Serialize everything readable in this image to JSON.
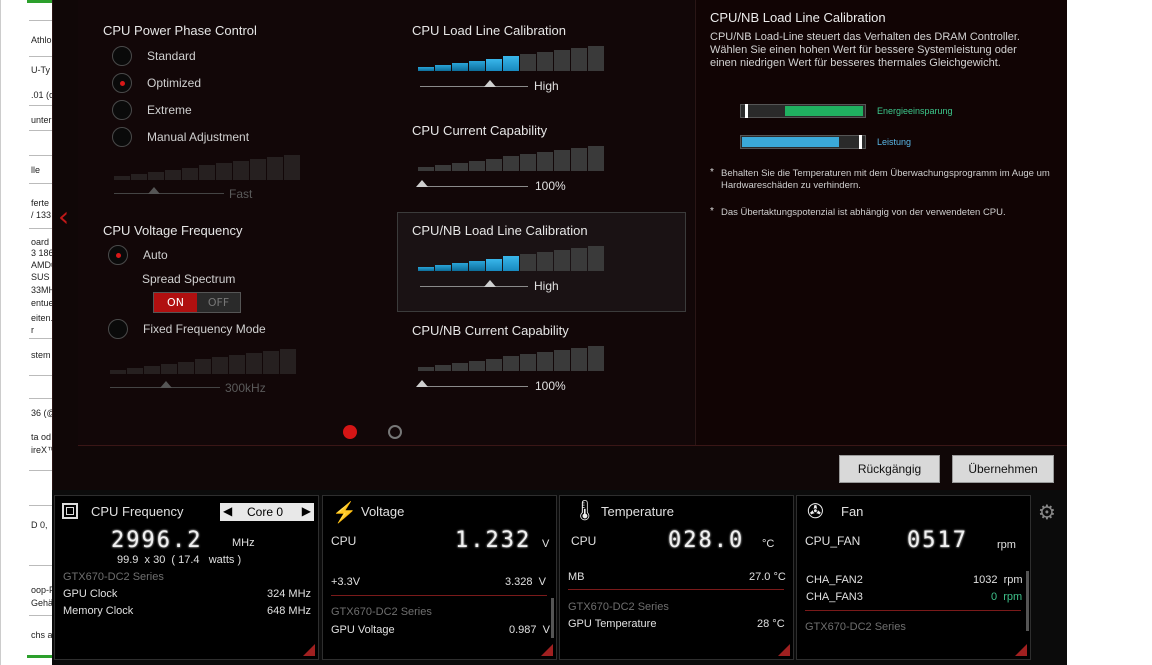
{
  "background_fragments": [
    "Athlo",
    "U-Ty",
    ".01 (c",
    "unter",
    "lle",
    "ferte",
    "/ 133",
    "oard",
    "3 186",
    "AMD®",
    "SUS",
    "33MH",
    "entue",
    "eiten.",
    "r",
    "stem",
    "36 (@",
    "ta od",
    "ireX™",
    "D 0,",
    "oop-F",
    "Gehäu",
    "chs a"
  ],
  "power_phase": {
    "title": "CPU Power Phase Control",
    "options": [
      "Standard",
      "Optimized",
      "Extreme",
      "Manual Adjustment"
    ],
    "selected": "Optimized",
    "slider_value": "Fast"
  },
  "voltage_freq": {
    "title": "CPU Voltage Frequency",
    "auto_label": "Auto",
    "spread_label": "Spread Spectrum",
    "on_label": "ON",
    "off_label": "OFF",
    "fixed_label": "Fixed Frequency Mode",
    "slider_value": "300kHz"
  },
  "llc": {
    "title": "CPU Load Line Calibration",
    "value": "High",
    "level": 0.55
  },
  "current_cap": {
    "title": "CPU Current Capability",
    "value": "100%",
    "level": 0.0
  },
  "nb_llc": {
    "title": "CPU/NB Load Line Calibration",
    "value": "High",
    "level": 0.55
  },
  "nb_current_cap": {
    "title": "CPU/NB Current Capability",
    "value": "100%",
    "level": 0.0
  },
  "help": {
    "title": "CPU/NB Load Line Calibration",
    "body": "CPU/NB Load-Line steuert das Verhalten des DRAM Controller. Wählen Sie einen hohen Wert für bessere Systemleistung oder einen niedrigen Wert für besseres thermales Gleichgewicht.",
    "meter1_label": "Energieeinsparung",
    "meter2_label": "Leistung",
    "note1": "Behalten Sie die Temperaturen mit dem Überwachungsprogramm im Auge um Hardwareschäden zu verhindern.",
    "note2": "Das Übertaktungspotenzial ist abhängig von der verwendeten CPU."
  },
  "buttons": {
    "undo": "Rückgängig",
    "apply": "Übernehmen"
  },
  "cpu_freq": {
    "title": "CPU Frequency",
    "core": "Core 0",
    "value": "2996.2",
    "unit": "MHz",
    "detail": "99.9  x 30  ( 17.4   watts )",
    "gpu_series": "GTX670-DC2 Series",
    "gpu_clock_label": "GPU Clock",
    "gpu_clock": "324 MHz",
    "mem_clock_label": "Memory Clock",
    "mem_clock": "648 MHz"
  },
  "voltage": {
    "title": "Voltage",
    "cpu_label": "CPU",
    "cpu_value": "1.232",
    "unit": "V",
    "v33_label": "+3.3V",
    "v33_value": "3.328  V",
    "gpu_series": "GTX670-DC2 Series",
    "gpu_v_label": "GPU Voltage",
    "gpu_v_value": "0.987  V"
  },
  "temperature": {
    "title": "Temperature",
    "cpu_label": "CPU",
    "cpu_value": "028.0",
    "unit": "°C",
    "mb_label": "MB",
    "mb_value": "27.0 °C",
    "gpu_series": "GTX670-DC2 Series",
    "gpu_t_label": "GPU Temperature",
    "gpu_t_value": "28 °C"
  },
  "fan": {
    "title": "Fan",
    "cpu_fan_label": "CPU_FAN",
    "cpu_fan_value": "0517",
    "unit": "rpm",
    "cha2_label": "CHA_FAN2",
    "cha2_value": "1032  rpm",
    "cha3_label": "CHA_FAN3",
    "cha3_value": "0  rpm",
    "gpu_series": "GTX670-DC2 Series"
  },
  "colors": {
    "accent_red": "#c01818",
    "bar_blue": "#1a8fc0",
    "meter_green": "#20b060",
    "meter_blue": "#3aa8d8"
  }
}
